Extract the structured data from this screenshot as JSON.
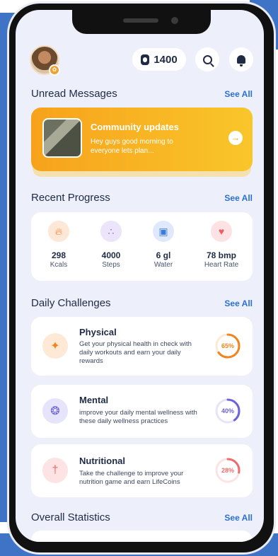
{
  "header": {
    "coins": "1400",
    "icons": {
      "avatar_badge": "settings-icon",
      "coin": "coin-icon",
      "search": "search-icon",
      "notifications": "bell-icon"
    }
  },
  "unread": {
    "title": "Unread Messages",
    "see_all": "See All",
    "card": {
      "title": "Community updates",
      "text": "Hey guys good morning to everyone lets plan...",
      "arrow": "→"
    }
  },
  "progress": {
    "title": "Recent Progress",
    "see_all": "See All",
    "items": [
      {
        "icon": "flame-icon",
        "value": "298",
        "label": "Kcals",
        "color": "#f47c2b",
        "bg": "#fde7d6"
      },
      {
        "icon": "footsteps-icon",
        "value": "4000",
        "label": "Steps",
        "color": "#8a63d2",
        "bg": "#ece4fa"
      },
      {
        "icon": "water-glass-icon",
        "value": "6 gl",
        "label": "Water",
        "color": "#3a7ad8",
        "bg": "#dfe9fb"
      },
      {
        "icon": "heart-rate-icon",
        "value": "78 bmp",
        "label": "Heart Rate",
        "color": "#ef5d64",
        "bg": "#fde2e4"
      }
    ]
  },
  "challenges": {
    "title": "Daily Challenges",
    "see_all": "See All",
    "items": [
      {
        "icon": "dumbbell-icon",
        "title": "Physical",
        "text": "Get your physical health in check with daily workouts and earn your daily rewards",
        "percent": "65%",
        "progress": 0.65,
        "color": "#f0841f",
        "bg": "#fde9d6"
      },
      {
        "icon": "brain-icon",
        "title": "Mental",
        "text": "improve your daily mental wellness with these daily wellness practices",
        "percent": "40%",
        "progress": 0.4,
        "color": "#6c63d9",
        "bg": "#e6e4fa"
      },
      {
        "icon": "cutlery-icon",
        "title": "Nutritional",
        "text": "Take the challenge to improve your nutrition game and earn LifeCoins",
        "percent": "28%",
        "progress": 0.28,
        "color": "#ef6a6a",
        "bg": "#fde3e3"
      }
    ]
  },
  "stats": {
    "title": "Overall Statistics",
    "see_all": "See All"
  }
}
